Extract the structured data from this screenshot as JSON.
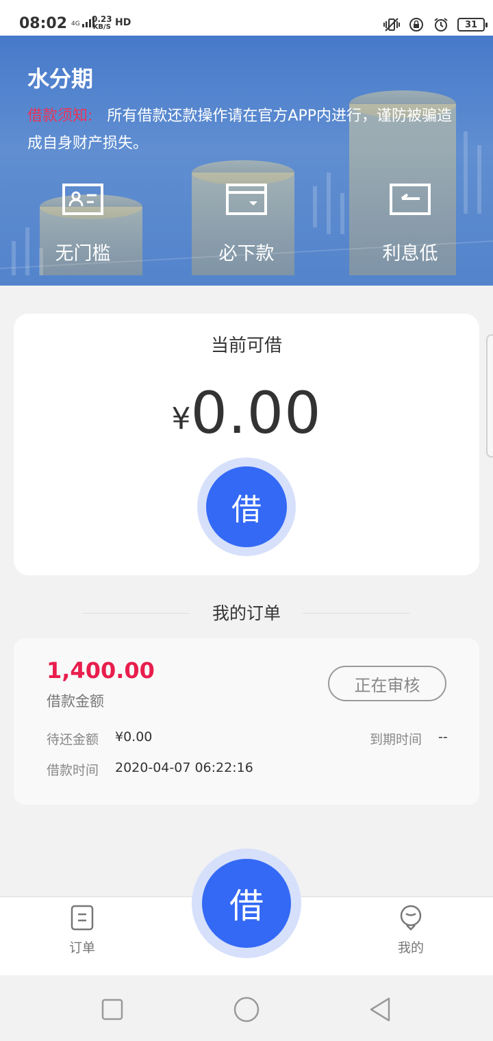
{
  "status_bar": {
    "time": "08:02",
    "network_type": "4G",
    "speed_value": "0.23",
    "speed_unit": "KB/S",
    "hd_label": "HD",
    "battery_level": "31",
    "icons": [
      "vibrate-icon",
      "rotation-lock-icon",
      "alarm-icon",
      "battery-icon"
    ]
  },
  "hero": {
    "app_title": "水分期",
    "notice_label": "借款须知:",
    "notice_text": "所有借款还款操作请在官方APP内进行，谨防被骗造成自身财产损失。",
    "features": [
      {
        "label": "无门槛",
        "icon": "id-card-icon"
      },
      {
        "label": "必下款",
        "icon": "wallet-icon"
      },
      {
        "label": "利息低",
        "icon": "return-icon"
      }
    ],
    "colors": {
      "notice_label": "#e8345a"
    }
  },
  "quota": {
    "label": "当前可借",
    "currency": "¥",
    "amount": "0.00",
    "borrow_button": "借"
  },
  "orders": {
    "section_title": "我的订单",
    "items": [
      {
        "amount": "1,400.00",
        "amount_label": "借款金额",
        "status": "正在审核",
        "pending_label": "待还金额",
        "pending_value": "¥0.00",
        "due_label": "到期时间",
        "due_value": "--",
        "time_label": "借款时间",
        "time_value": "2020-04-07 06:22:16"
      }
    ]
  },
  "bottom_nav": {
    "orders_label": "订单",
    "fab_label": "借",
    "mine_label": "我的"
  },
  "colors": {
    "accent_blue": "#3369f5",
    "amount_red": "#e81e4d"
  }
}
